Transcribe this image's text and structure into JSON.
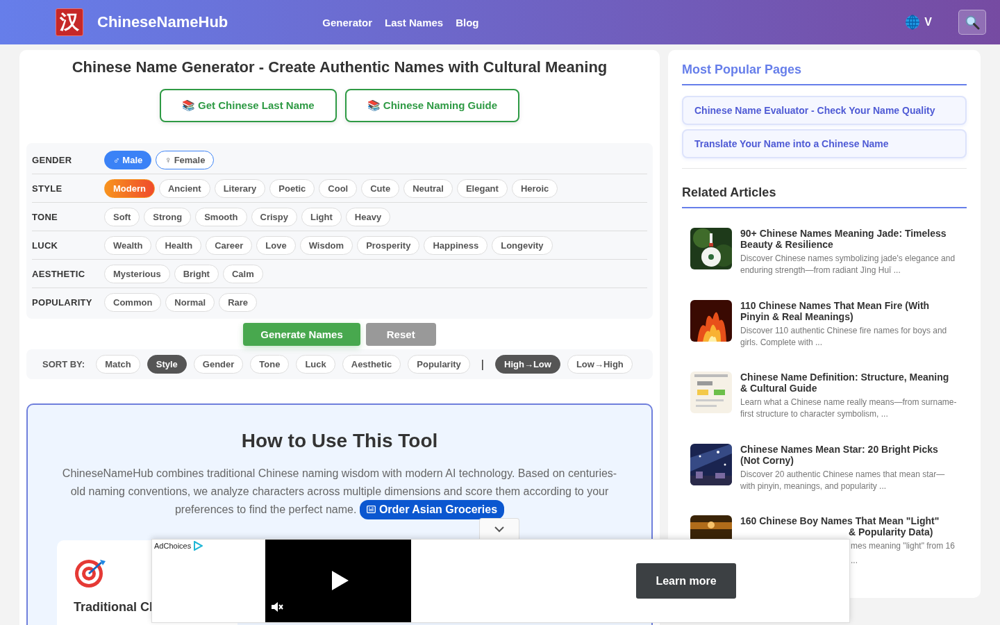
{
  "header": {
    "logo_char": "汉",
    "brand": "ChineseNameHub",
    "nav": [
      "Generator",
      "Last Names",
      "Blog"
    ],
    "language_label": "V"
  },
  "main": {
    "title": "Chinese Name Generator - Create Authentic Names with Cultural Meaning",
    "link_buttons": [
      {
        "icon": "📚",
        "label": "Get Chinese Last Name"
      },
      {
        "icon": "📚",
        "label": "Chinese Naming Guide"
      }
    ],
    "filters": [
      {
        "label": "GENDER",
        "kind": "gender",
        "options": [
          {
            "label": "♂ Male",
            "selected": true
          },
          {
            "label": "♀ Female",
            "selected": false
          }
        ]
      },
      {
        "label": "STYLE",
        "kind": "trait",
        "options": [
          {
            "label": "Modern",
            "selected": true
          },
          {
            "label": "Ancient",
            "selected": false
          },
          {
            "label": "Literary",
            "selected": false
          },
          {
            "label": "Poetic",
            "selected": false
          },
          {
            "label": "Cool",
            "selected": false
          },
          {
            "label": "Cute",
            "selected": false
          },
          {
            "label": "Neutral",
            "selected": false
          },
          {
            "label": "Elegant",
            "selected": false
          },
          {
            "label": "Heroic",
            "selected": false
          }
        ]
      },
      {
        "label": "TONE",
        "kind": "trait",
        "options": [
          {
            "label": "Soft",
            "selected": false
          },
          {
            "label": "Strong",
            "selected": false
          },
          {
            "label": "Smooth",
            "selected": false
          },
          {
            "label": "Crispy",
            "selected": false
          },
          {
            "label": "Light",
            "selected": false
          },
          {
            "label": "Heavy",
            "selected": false
          }
        ]
      },
      {
        "label": "LUCK",
        "kind": "trait",
        "options": [
          {
            "label": "Wealth",
            "selected": false
          },
          {
            "label": "Health",
            "selected": false
          },
          {
            "label": "Career",
            "selected": false
          },
          {
            "label": "Love",
            "selected": false
          },
          {
            "label": "Wisdom",
            "selected": false
          },
          {
            "label": "Prosperity",
            "selected": false
          },
          {
            "label": "Happiness",
            "selected": false
          },
          {
            "label": "Longevity",
            "selected": false
          }
        ]
      },
      {
        "label": "AESTHETIC",
        "kind": "trait",
        "options": [
          {
            "label": "Mysterious",
            "selected": false
          },
          {
            "label": "Bright",
            "selected": false
          },
          {
            "label": "Calm",
            "selected": false
          }
        ]
      },
      {
        "label": "POPULARITY",
        "kind": "trait",
        "options": [
          {
            "label": "Common",
            "selected": false
          },
          {
            "label": "Normal",
            "selected": false
          },
          {
            "label": "Rare",
            "selected": false
          }
        ]
      }
    ],
    "actions": [
      {
        "label": "Generate Names",
        "kind": "primary"
      },
      {
        "label": "Reset",
        "kind": "secondary"
      }
    ],
    "sort": {
      "label": "SORT BY:",
      "fields": [
        {
          "label": "Match",
          "selected": false
        },
        {
          "label": "Style",
          "selected": true
        },
        {
          "label": "Gender",
          "selected": false
        },
        {
          "label": "Tone",
          "selected": false
        },
        {
          "label": "Luck",
          "selected": false
        },
        {
          "label": "Aesthetic",
          "selected": false
        },
        {
          "label": "Popularity",
          "selected": false
        }
      ],
      "separator": "|",
      "orders": [
        {
          "label": "High→Low",
          "selected": true
        },
        {
          "label": "Low→High",
          "selected": false
        }
      ]
    },
    "how_to": {
      "title": "How to Use This Tool",
      "text": "ChineseNameHub combines traditional Chinese naming wisdom with modern AI technology. Based on centuries-old naming conventions, we analyze characters across multiple dimensions and score them according to your preferences to find the perfect name.",
      "link": "Order Asian Groceries",
      "features": [
        {
          "title": "Traditional Cl"
        }
      ]
    }
  },
  "sidebar": {
    "popular_title": "Most Popular Pages",
    "popular_links": [
      "Chinese Name Evaluator - Check Your Name Quality",
      "Translate Your Name into a Chinese Name"
    ],
    "related_title": "Related Articles",
    "articles": [
      {
        "title": "90+ Chinese Names Meaning Jade: Timeless Beauty & Resilience",
        "description": "Discover Chinese names symbolizing jade's elegance and enduring strength—from radiant Jìng Huī ..."
      },
      {
        "title": "110 Chinese Names That Mean Fire (With Pinyin & Real Meanings)",
        "description": "Discover 110 authentic Chinese fire names for boys and girls. Complete with ..."
      },
      {
        "title": "Chinese Name Definition: Structure, Meaning & Cultural Guide",
        "description": "Learn what a Chinese name really means—from surname-first structure to character symbolism, ..."
      },
      {
        "title": "Chinese Names Mean Star: 20 Bright Picks (Not Corny)",
        "description": "Discover 20 authentic Chinese names that mean star—with pinyin, meanings, and popularity ..."
      },
      {
        "title": "160 Chinese Boy Names That Mean \"Light\"",
        "fragments": [
          "& Popularity Data)",
          "mes meaning \"light\" from 16",
          "..."
        ]
      }
    ]
  },
  "ad": {
    "adchoices": "AdChoices",
    "button": "Learn more"
  }
}
